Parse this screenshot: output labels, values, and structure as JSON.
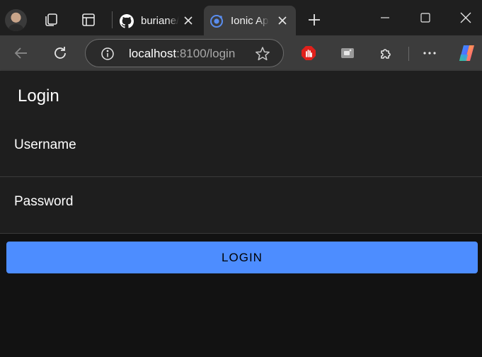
{
  "browser": {
    "tabs": [
      {
        "title": "buriane/",
        "favicon": "github-icon",
        "active": false
      },
      {
        "title": "Ionic App",
        "favicon": "ionic-icon",
        "active": true
      }
    ],
    "address": {
      "host": "localhost",
      "rest": ":8100/login"
    },
    "colors": {
      "tabstrip": "#1f1f1f",
      "toolbar": "#3c3c3c",
      "active_tab": "#3c3c3c"
    }
  },
  "app": {
    "header_title": "Login",
    "form": {
      "username_label": "Username",
      "password_label": "Password",
      "username_value": "",
      "password_value": ""
    },
    "login_button_label": "LOGIN",
    "colors": {
      "primary": "#4d8dff",
      "background": "#121212",
      "item_background": "#1e1e1e"
    }
  }
}
